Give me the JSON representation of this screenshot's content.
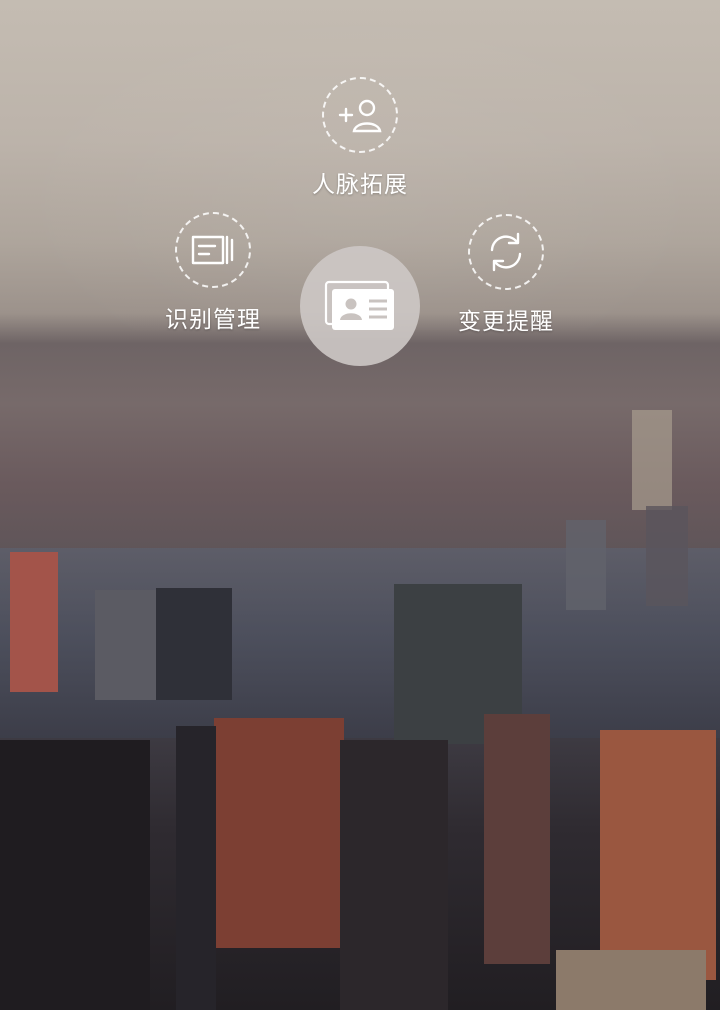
{
  "menu": {
    "network_expand_label": "人脉拓展",
    "recognition_manage_label": "识别管理",
    "change_reminder_label": "变更提醒"
  },
  "icons": {
    "network_expand": "add-person-icon",
    "recognition_manage": "card-list-icon",
    "change_reminder": "refresh-cycle-icon",
    "center": "business-card-icon"
  },
  "colors": {
    "icon_stroke": "#ffffff",
    "center_button": "#cdc8c5"
  }
}
